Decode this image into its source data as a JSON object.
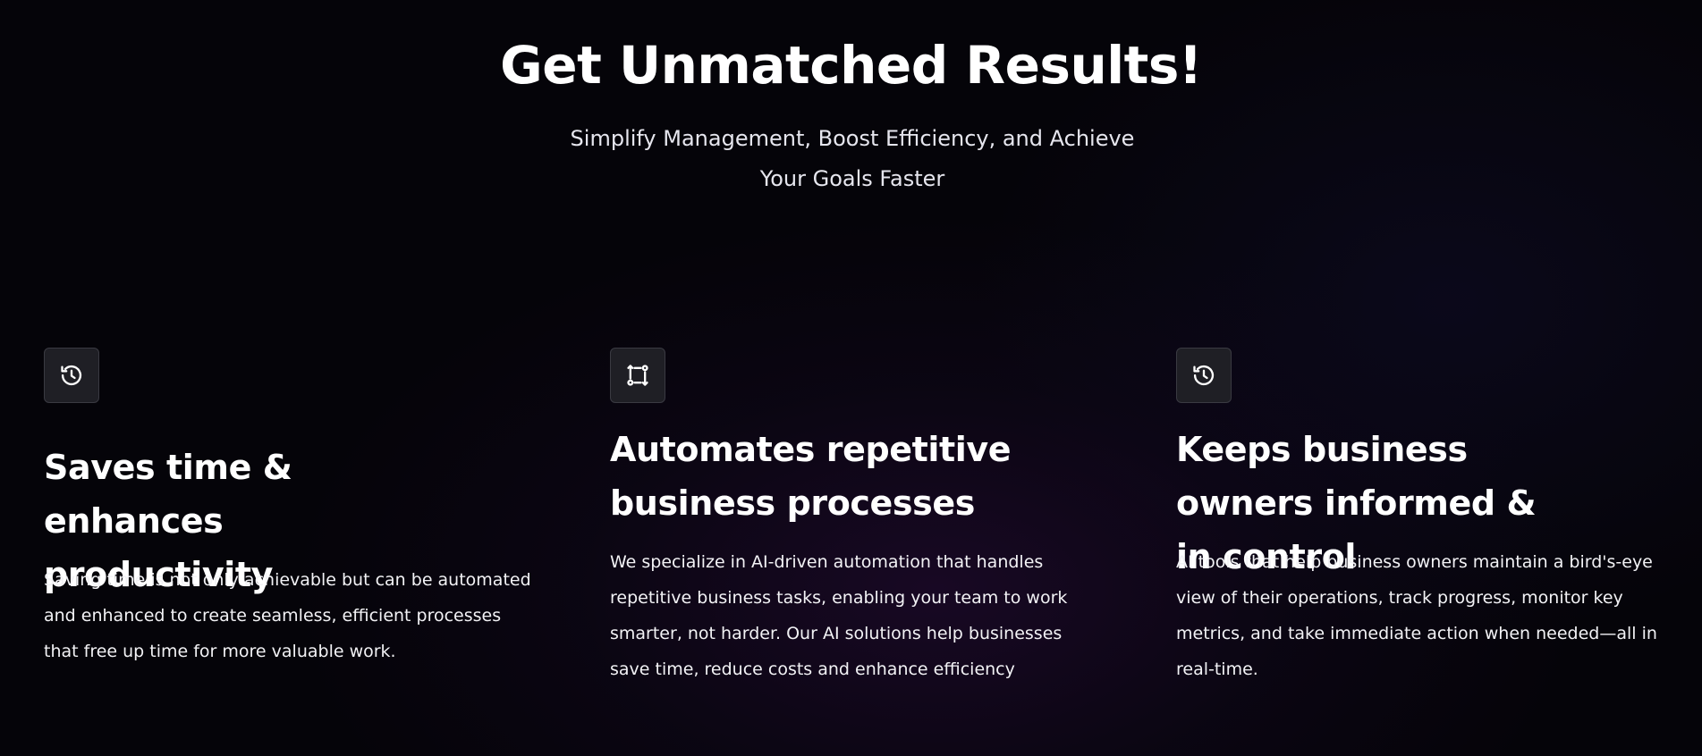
{
  "hero": {
    "title": "Get Unmatched Results!",
    "subtitle": "Simplify Management, Boost Efficiency, and Achieve Your Goals Faster"
  },
  "features": [
    {
      "icon": "history-clock-icon",
      "title": "Saves time & enhances productivity",
      "description": "Saving time is not only achievable but can be automated and enhanced to create seamless, efficient processes that free up time for more valuable work."
    },
    {
      "icon": "workflow-arrows-icon",
      "title": "Automates repetitive business processes",
      "description": "We specialize in AI-driven automation that handles repetitive business tasks, enabling your team to work smarter, not harder. Our AI solutions help businesses save time, reduce costs and enhance efficiency"
    },
    {
      "icon": "history-clock-icon",
      "title": "Keeps business owners informed & in control",
      "description": "AI tools that help business owners maintain a bird's-eye view of their operations, track progress, monitor key metrics, and take immediate action when needed—all in real-time."
    }
  ]
}
